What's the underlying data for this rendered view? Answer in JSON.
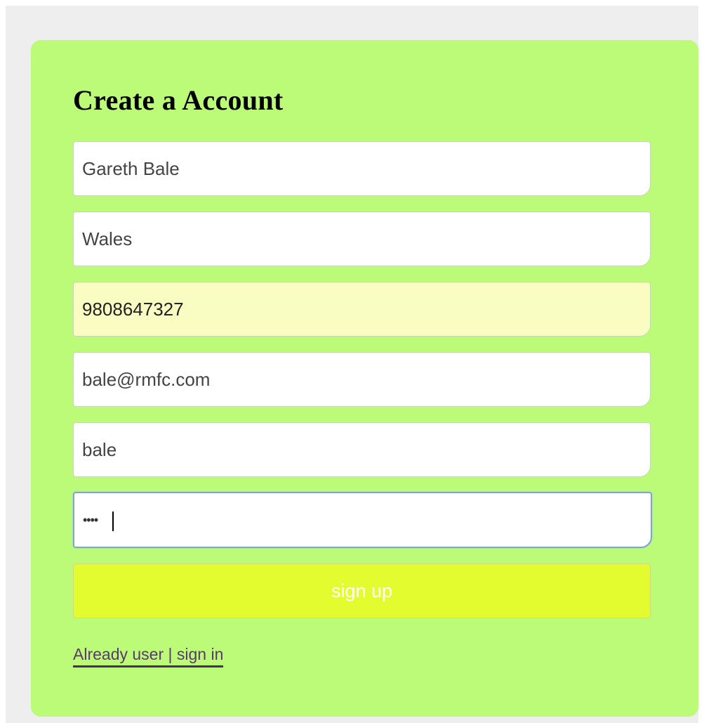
{
  "form": {
    "title": "Create a Account",
    "fields": [
      {
        "name": "full-name",
        "value": "Gareth Bale"
      },
      {
        "name": "country",
        "value": "Wales"
      },
      {
        "name": "phone",
        "value": "9808647327"
      },
      {
        "name": "email",
        "value": "bale@rmfc.com"
      },
      {
        "name": "username",
        "value": "bale"
      },
      {
        "name": "password",
        "value": "bale"
      }
    ],
    "submit_label": "sign up",
    "signin_link_label": "Already user | sign in"
  },
  "colors": {
    "page_background": "#eeeeee",
    "card_background": "#bcfb78",
    "button_background": "#e2fc2f",
    "autofill_background": "#fafdc1",
    "link_color": "#5a3a6e"
  }
}
